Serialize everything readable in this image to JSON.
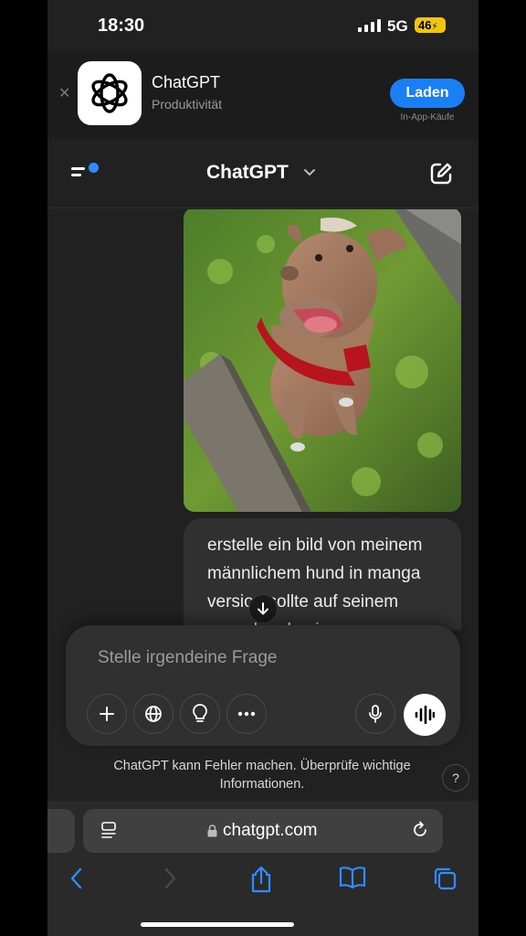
{
  "status": {
    "time": "18:30",
    "network": "5G",
    "battery": "46"
  },
  "banner": {
    "app_name": "ChatGPT",
    "category": "Produktivität",
    "get_label": "Laden",
    "iap_label": "In-App-Käufe"
  },
  "header": {
    "title": "ChatGPT"
  },
  "chat": {
    "user_message": "erstelle ein bild von meinem männlichem hund in manga version sollte auf seinem aussehen basieren"
  },
  "composer": {
    "placeholder": "Stelle irgendeine Frage"
  },
  "disclaimer": "ChatGPT kann Fehler machen. Überprüfe wichtige Informationen.",
  "help_label": "?",
  "browser": {
    "url": "chatgpt.com"
  },
  "colors": {
    "accent": "#1a7ef5",
    "background": "#212121",
    "bubble": "#303030",
    "notification_dot": "#2f8cff"
  }
}
